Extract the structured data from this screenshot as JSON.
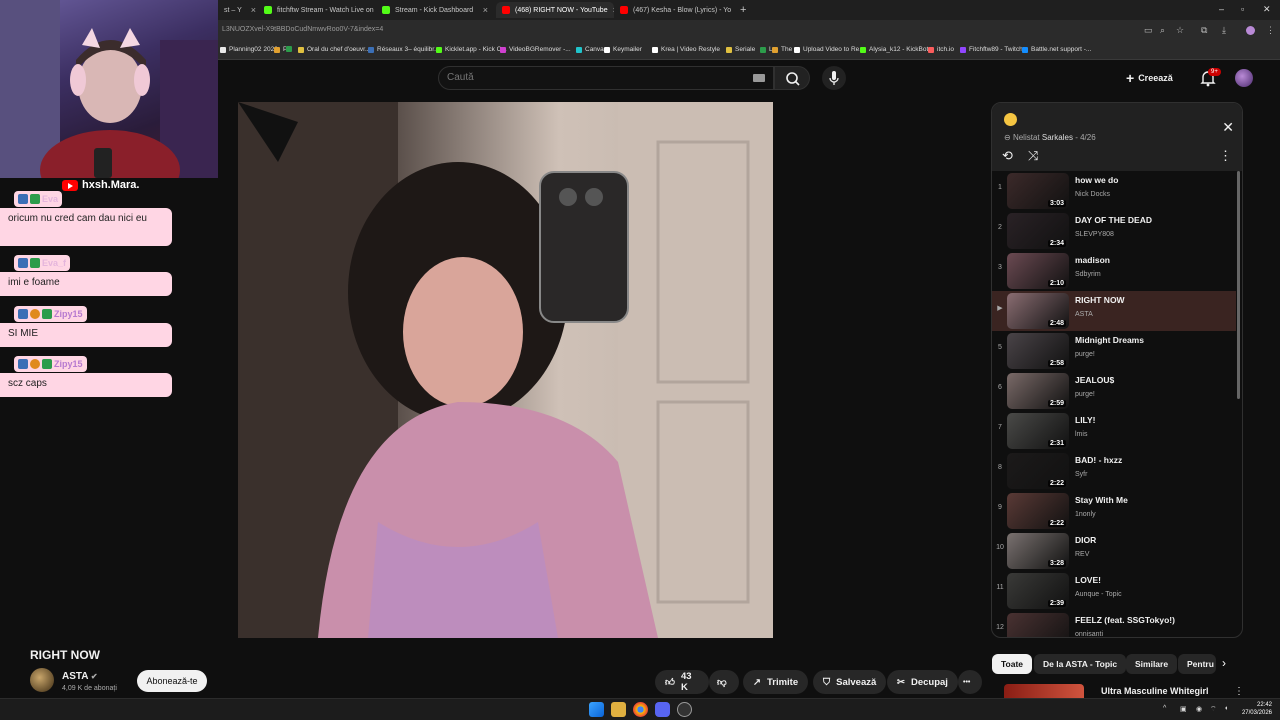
{
  "browser": {
    "tabs": [
      {
        "label": "st – Y",
        "color": "#ff0000",
        "active": false
      },
      {
        "label": "fitchftw Stream - Watch Live on",
        "color": "#53fc18",
        "active": false
      },
      {
        "label": "Stream - Kick Dashboard",
        "color": "#53fc18",
        "active": false
      },
      {
        "label": "(468) RIGHT NOW - YouTube",
        "color": "#ff0000",
        "active": true
      },
      {
        "label": "(467) Kesha - Blow (Lyrics) - Yo",
        "color": "#ff0000",
        "active": false
      }
    ],
    "new_tab": "+",
    "url": "L3NUOZXvel-X9tBBDoCudNmwvRoo0V-7&index=4",
    "bookmarks": [
      {
        "label": "Planning02 2026",
        "color": "#e8e8e8"
      },
      {
        "label": "P",
        "color": "#e0a030"
      },
      {
        "label": "",
        "color": "#2c9c4b"
      },
      {
        "label": "Oral du chef d'oeuvr...",
        "color": "#e0c040"
      },
      {
        "label": "Réseaux 3– équilibr...",
        "color": "#3b6fb6"
      },
      {
        "label": "Kicklet.app - Kick C...",
        "color": "#53fc18"
      },
      {
        "label": "VideoBGRemover -...",
        "color": "#d040d0"
      },
      {
        "label": "Canva",
        "color": "#20c4cb"
      },
      {
        "label": "Keymailer",
        "color": "#ffffff"
      },
      {
        "label": "Krea | Video Restyle",
        "color": "#ffffff"
      },
      {
        "label": "Seriale",
        "color": "#e0c040"
      },
      {
        "label": "L",
        "color": "#2c9c4b"
      },
      {
        "label": "The",
        "color": "#e0a030"
      },
      {
        "label": "Upload Video to Re...",
        "color": "#ffffff"
      },
      {
        "label": "Alysia_k12 - KickBot",
        "color": "#53fc18"
      },
      {
        "label": "itch.io",
        "color": "#fa5c5c"
      },
      {
        "label": "Fitchftw89 - Twitch",
        "color": "#9146ff"
      },
      {
        "label": "Battle.net support -...",
        "color": "#148eff"
      }
    ]
  },
  "youtube": {
    "search_placeholder": "Caută",
    "create_label": "Creează",
    "notif_count": "9+"
  },
  "overlay": {
    "channel": "hxsh.Mara.",
    "chat": [
      {
        "user": "Eva",
        "message": "oricum nu cred cam dau nici eu"
      },
      {
        "user": "Eva_f",
        "message": "imi e foame"
      },
      {
        "user": "Zipy15",
        "message": "SI MIE"
      },
      {
        "user": "Zipy15",
        "message": "scz caps"
      }
    ]
  },
  "video": {
    "title": "RIGHT NOW",
    "channel": "ASTA",
    "subscribers": "4,09 K de abonați",
    "subscribe_label": "Abonează-te",
    "likes": "43 K",
    "share_label": "Trimite",
    "save_label": "Salvează",
    "clip_label": "Decupaj",
    "more_label": "•••"
  },
  "playlist": {
    "status": "Nelistat",
    "owner": "Sarkales",
    "position": "4/26",
    "items": [
      {
        "index": "1",
        "title": "how we do",
        "artist": "Nick Docks",
        "duration": "3:03",
        "thumb": "#3c2a2a"
      },
      {
        "index": "2",
        "title": "DAY OF THE DEAD",
        "artist": "SLEVPY808",
        "duration": "2:34",
        "thumb": "#2a2226"
      },
      {
        "index": "3",
        "title": "madison",
        "artist": "Sdbyrim",
        "duration": "2:10",
        "thumb": "#6b4a52"
      },
      {
        "index": "▶",
        "title": "RIGHT NOW",
        "artist": "ASTA",
        "duration": "2:48",
        "thumb": "#8a6d72",
        "current": true
      },
      {
        "index": "5",
        "title": "Midnight Dreams",
        "artist": "purge!",
        "duration": "2:58",
        "thumb": "#4a4448"
      },
      {
        "index": "6",
        "title": "JEALOU$",
        "artist": "purge!",
        "duration": "2:59",
        "thumb": "#7a6a68"
      },
      {
        "index": "7",
        "title": "LILY!",
        "artist": "lmis",
        "duration": "2:31",
        "thumb": "#4a4a48"
      },
      {
        "index": "8",
        "title": "BAD! - hxzz",
        "artist": "Syfr",
        "duration": "2:22",
        "thumb": "#1c1a1a"
      },
      {
        "index": "9",
        "title": "Stay With Me",
        "artist": "1nonly",
        "duration": "2:22",
        "thumb": "#5a3a36"
      },
      {
        "index": "10",
        "title": "DIOR",
        "artist": "REV",
        "duration": "3:28",
        "thumb": "#7a7270"
      },
      {
        "index": "11",
        "title": "LOVE!",
        "artist": "Aunque - Topic",
        "duration": "2:39",
        "thumb": "#3a3a38"
      },
      {
        "index": "12",
        "title": "FEELZ (feat. SSGTokyo!)",
        "artist": "onnisanti",
        "duration": "2:41",
        "thumb": "#4a3232"
      }
    ]
  },
  "chips": [
    "Toate",
    "De la ASTA - Topic",
    "Similare",
    "Pentru"
  ],
  "recommended": {
    "title": "Ultra Masculine Whitegirl"
  },
  "taskbar": {
    "time": "22:42",
    "date": "27/03/2026"
  }
}
